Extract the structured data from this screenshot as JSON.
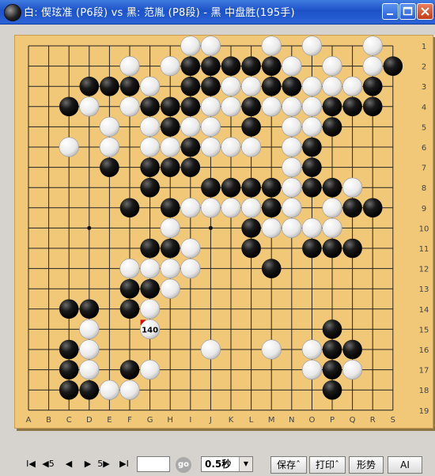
{
  "window": {
    "title": "白: 偰玹准 (P6段) vs 黑: 范胤 (P8段) - 黑 中盘胜(195手)",
    "buttons": [
      "minimize",
      "maximize",
      "close"
    ],
    "accent": "#2b62d6"
  },
  "board": {
    "size": 19,
    "col_labels": [
      "A",
      "B",
      "C",
      "D",
      "E",
      "F",
      "G",
      "H",
      "I",
      "J",
      "K",
      "L",
      "M",
      "N",
      "O",
      "P",
      "Q",
      "R",
      "S"
    ],
    "row_labels": [
      "1",
      "2",
      "3",
      "4",
      "5",
      "6",
      "7",
      "8",
      "9",
      "10",
      "11",
      "12",
      "13",
      "14",
      "15",
      "16",
      "17",
      "18",
      "19"
    ],
    "board_color": "#f1c878",
    "last_move_label": "140",
    "last_move_point": "G15",
    "stones": {
      "black": [
        "I2",
        "J2",
        "K2",
        "L2",
        "M2",
        "S2",
        "D3",
        "E3",
        "F3",
        "I3",
        "J3",
        "M3",
        "N3",
        "R3",
        "C4",
        "G4",
        "H4",
        "I4",
        "L4",
        "P4",
        "Q4",
        "R4",
        "H5",
        "L5",
        "P5",
        "I6",
        "O6",
        "E7",
        "G7",
        "H7",
        "I7",
        "O7",
        "G8",
        "J8",
        "K8",
        "L8",
        "M8",
        "O8",
        "P8",
        "F9",
        "H9",
        "M9",
        "Q9",
        "R9",
        "L10",
        "G11",
        "H11",
        "L11",
        "O11",
        "P11",
        "Q11",
        "M12",
        "F13",
        "G13",
        "C14",
        "D14",
        "F14",
        "P15",
        "C16",
        "P16",
        "Q16",
        "C17",
        "F17",
        "P17",
        "C18",
        "D18",
        "P18"
      ],
      "white": [
        "I1",
        "J1",
        "M1",
        "O1",
        "R1",
        "F2",
        "H2",
        "N2",
        "P2",
        "R2",
        "G3",
        "K3",
        "L3",
        "O3",
        "P3",
        "Q3",
        "D4",
        "F4",
        "J4",
        "K4",
        "M4",
        "N4",
        "O4",
        "E5",
        "G5",
        "I5",
        "J5",
        "N5",
        "O5",
        "C6",
        "E6",
        "G6",
        "H6",
        "J6",
        "K6",
        "L6",
        "N6",
        "N7",
        "N8",
        "Q8",
        "I9",
        "J9",
        "K9",
        "L9",
        "N9",
        "P9",
        "H10",
        "M10",
        "N10",
        "O10",
        "P10",
        "I11",
        "F12",
        "G12",
        "H12",
        "I12",
        "H13",
        "G14",
        "G15",
        "D15",
        "D16",
        "J16",
        "M16",
        "O16",
        "D17",
        "G17",
        "O17",
        "Q17",
        "E18",
        "F18"
      ]
    }
  },
  "controls": {
    "nav_buttons": [
      {
        "name": "first-move-button",
        "label": "I◀"
      },
      {
        "name": "back5-button",
        "label": "◀5"
      },
      {
        "name": "prev-button",
        "label": "◀"
      },
      {
        "name": "next-button",
        "label": "▶"
      },
      {
        "name": "fwd5-button",
        "label": "5▶"
      },
      {
        "name": "last-move-button",
        "label": "▶I"
      }
    ],
    "move_number_value": "",
    "go_label": "go",
    "speed_value": "0.5秒",
    "save_label": "保存ˆ",
    "print_label": "打印ˆ",
    "situation_label": "形势",
    "ai_label": "AI"
  }
}
